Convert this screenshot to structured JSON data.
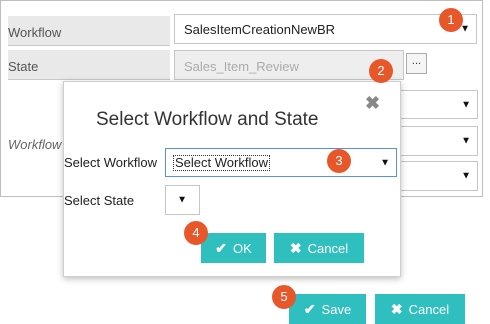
{
  "background": {
    "workflow_label": "Workflow",
    "workflow_value": "SalesItemCreationNewBR",
    "state_label": "State",
    "state_value": "Sales_Item_Review",
    "dots_label": "...",
    "workflow_side_label": "Workflow"
  },
  "modal": {
    "title": "Select Workflow and State",
    "close_glyph": "✖",
    "workflow_label": "Select Workflow",
    "workflow_value": "Select Workflow",
    "state_label": "Select State",
    "ok_label": "OK",
    "cancel_label": "Cancel"
  },
  "footer": {
    "save_label": "Save",
    "cancel_label": "Cancel"
  },
  "badges": [
    "1",
    "2",
    "3",
    "4",
    "5"
  ],
  "colors": {
    "accent": "#2fbfbf",
    "badge": "#e8572a"
  }
}
